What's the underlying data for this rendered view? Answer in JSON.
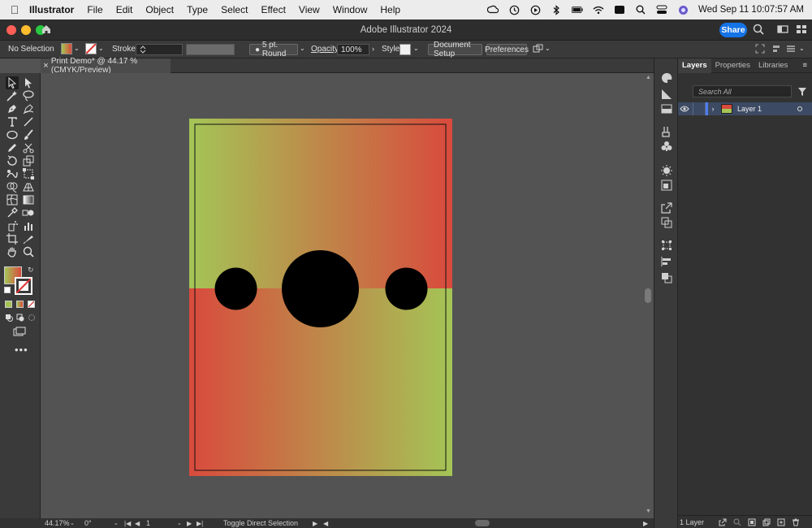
{
  "menubar": {
    "app": "Illustrator",
    "menus": [
      "File",
      "Edit",
      "Object",
      "Type",
      "Select",
      "Effect",
      "View",
      "Window",
      "Help"
    ],
    "datetime": "Wed Sep 11  10:07:57 AM"
  },
  "window": {
    "title": "Adobe Illustrator 2024",
    "share_label": "Share"
  },
  "control_bar": {
    "selection": "No Selection",
    "stroke_label": "Stroke:",
    "brush": "5 pt. Round",
    "opacity_label": "Opacity:",
    "opacity_value": "100%",
    "style_label": "Style:",
    "document_setup": "Document Setup",
    "preferences": "Preferences"
  },
  "document": {
    "tab_label": "Print Demo* @ 44.17 % (CMYK/Preview)",
    "close": "×",
    "gradient_left": "#a4c556",
    "gradient_right": "#d94a3d"
  },
  "status_bar": {
    "zoom": "44.17%",
    "rotation": "0°",
    "artboard": "1",
    "tool_hint": "Toggle Direct Selection"
  },
  "layers_panel": {
    "tabs": [
      "Layers",
      "Properties",
      "Libraries"
    ],
    "search_placeholder": "Search All",
    "layer_name": "Layer 1",
    "count": "1 Layer"
  }
}
